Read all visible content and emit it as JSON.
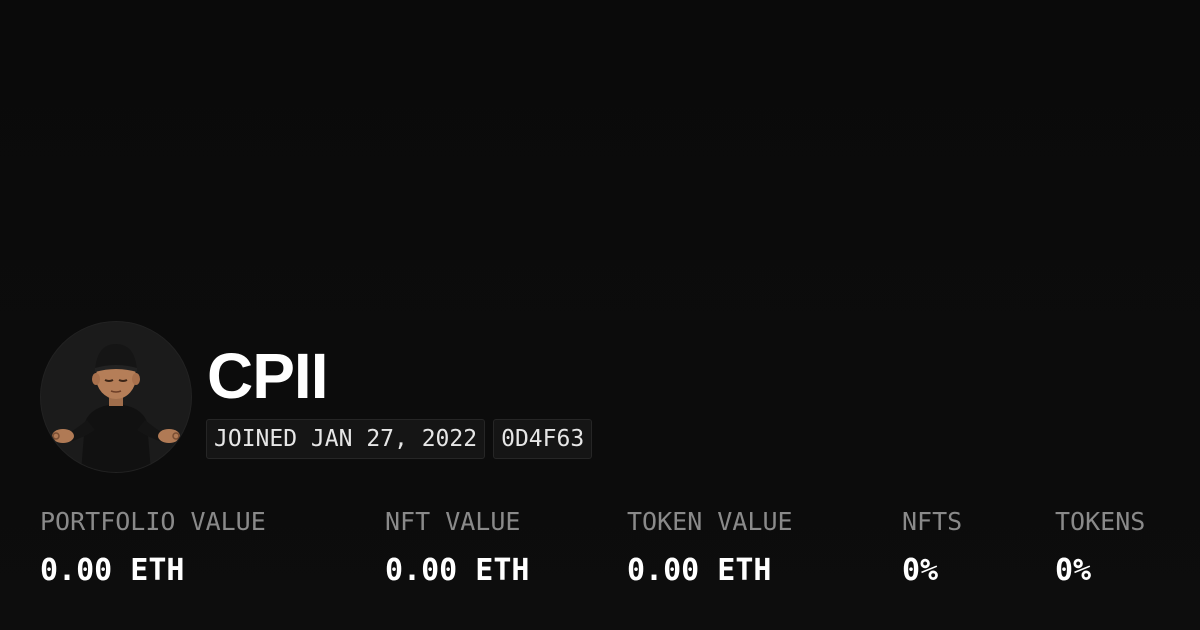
{
  "profile": {
    "name": "CPII",
    "joined": "JOINED JAN 27, 2022",
    "id_tag": "0D4F63",
    "avatar_icon": "memoji-meditating-avatar"
  },
  "stats": [
    {
      "label": "PORTFOLIO VALUE",
      "value": "0.00 ETH"
    },
    {
      "label": "NFT VALUE",
      "value": "0.00 ETH"
    },
    {
      "label": "TOKEN VALUE",
      "value": "0.00 ETH"
    },
    {
      "label": "NFTS",
      "value": "0%"
    },
    {
      "label": "TOKENS",
      "value": "0%"
    }
  ],
  "colors": {
    "background": "#0b0b0b",
    "text_primary": "#ffffff",
    "text_muted": "#8a8a8a",
    "tag_background": "#151515"
  }
}
